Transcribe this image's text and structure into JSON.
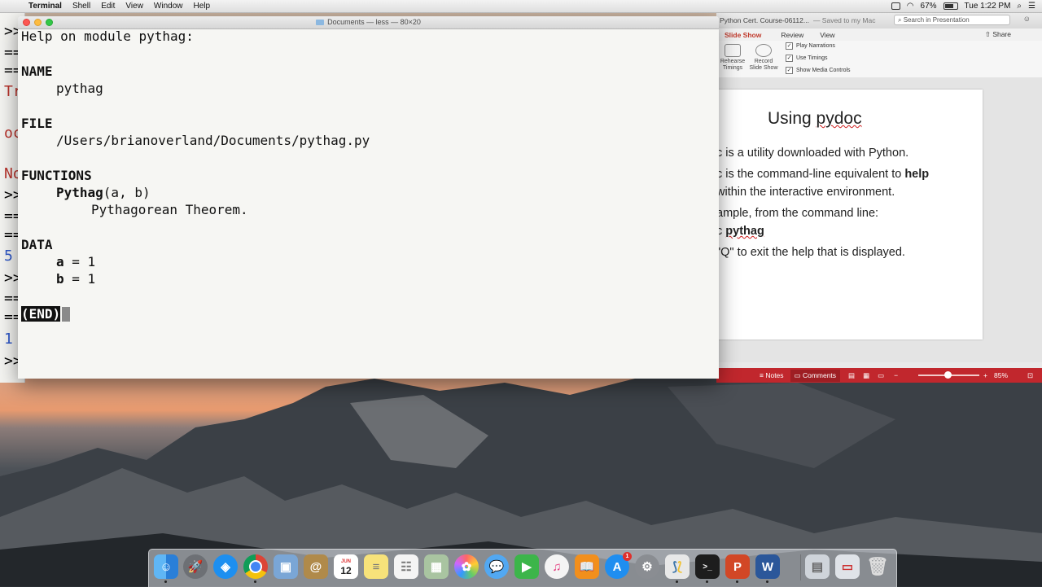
{
  "menubar": {
    "app": "Terminal",
    "items": [
      "Shell",
      "Edit",
      "View",
      "Window",
      "Help"
    ],
    "battery": "67%",
    "clock": "Tue 1:22 PM"
  },
  "terminal": {
    "title": "Documents — less — 80×20",
    "lines": {
      "l1": "Help on module pythag:",
      "name_head": "NAME",
      "name_val": "pythag",
      "file_head": "FILE",
      "file_val": "/Users/brianoverland/Documents/pythag.py",
      "func_head": "FUNCTIONS",
      "func_name": "Pythag",
      "func_args": "(a, b)",
      "func_doc": "Pythagorean Theorem.",
      "data_head": "DATA",
      "var_a": "a",
      "val_a": " = 1",
      "var_b": "b",
      "val_b": " = 1",
      "end": "(END)"
    }
  },
  "background_terminal": {
    "fragments": [
      ">>",
      "==",
      "==",
      "Tr",
      "oc",
      "No",
      ">>",
      "==",
      "==",
      "5",
      ">>",
      "==",
      "==",
      "1",
      ">>"
    ],
    "colors": {
      "red": "#b8322b",
      "blue": "#2e57c8"
    }
  },
  "powerpoint": {
    "doc_title": "Python Cert. Course-06112...",
    "saved": "— Saved to my Mac",
    "search_placeholder": "Search in Presentation",
    "tabs": [
      "Slide Show",
      "Review",
      "View"
    ],
    "share": "Share",
    "ribbon": {
      "rehearse": "Rehearse Timings",
      "record": "Record Slide Show",
      "checks": [
        "Play Narrations",
        "Use Timings",
        "Show Media Controls"
      ]
    },
    "slide": {
      "title_prefix": "Using ",
      "title_word": "pydoc",
      "bullets": [
        "c is a utility downloaded with Python.",
        "c is the command-line equivalent to ",
        "within the interactive environment.",
        "ample, from the command line:",
        "c ",
        "\"Q\" to exit the help that is displayed."
      ],
      "bold_help": "help",
      "bold_pythag": "pythag"
    },
    "statusbar": {
      "notes": "Notes",
      "comments": "Comments",
      "zoom": "85%"
    },
    "accent": "#c1272d"
  },
  "dock": {
    "calendar_day": "12",
    "calendar_month": "JUN",
    "appstore_badge": "1",
    "apps": [
      "finder-icon",
      "launchpad-icon",
      "safari-icon",
      "chrome-icon",
      "preview-icon",
      "contacts-icon",
      "calendar-icon",
      "notes-icon",
      "reminders-icon",
      "photobooth-icon",
      "photos-icon",
      "messages-icon",
      "facetime-icon",
      "itunes-icon",
      "ibooks-icon",
      "appstore-icon",
      "system-preferences-icon",
      "python-icon",
      "terminal-icon",
      "powerpoint-icon",
      "word-icon",
      "documents-folder-icon",
      "downloads-icon",
      "trash-icon"
    ]
  }
}
